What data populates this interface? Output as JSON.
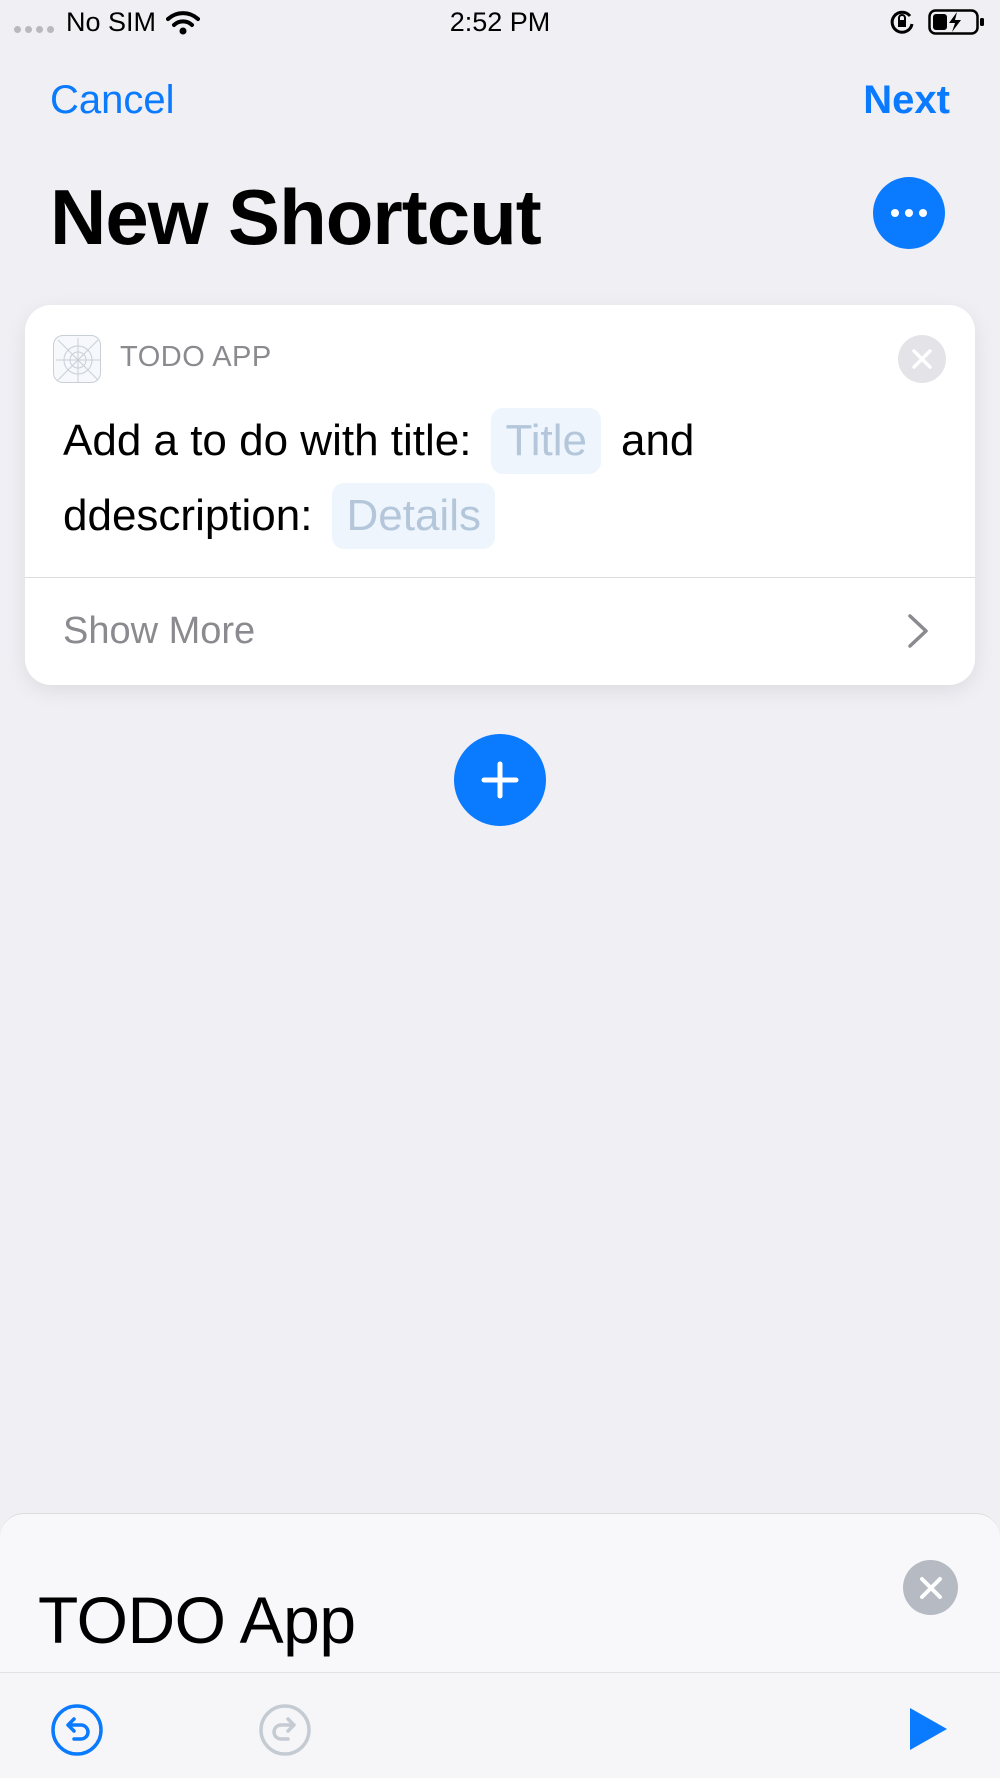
{
  "status_bar": {
    "carrier": "No SIM",
    "time": "2:52 PM"
  },
  "nav": {
    "cancel_label": "Cancel",
    "next_label": "Next",
    "title": "New Shortcut"
  },
  "action_card": {
    "app_name": "TODO APP",
    "text_part1": "Add a to do with title:",
    "title_param": "Title",
    "text_part2": "and",
    "text_part3": "ddescription:",
    "details_param": "Details",
    "show_more_label": "Show More"
  },
  "sheet": {
    "title": "TODO App"
  },
  "colors": {
    "accent": "#0a7aff",
    "background": "#efeff4",
    "param_text": "#b4c6da"
  },
  "icons": {
    "more": "ellipsis-icon",
    "add": "plus-icon",
    "close": "close-icon",
    "undo": "undo-icon",
    "redo": "redo-icon",
    "run": "play-icon",
    "chevron": "chevron-right-icon",
    "wifi": "wifi-icon",
    "rotation_lock": "rotation-lock-icon",
    "battery": "battery-charging-icon"
  }
}
